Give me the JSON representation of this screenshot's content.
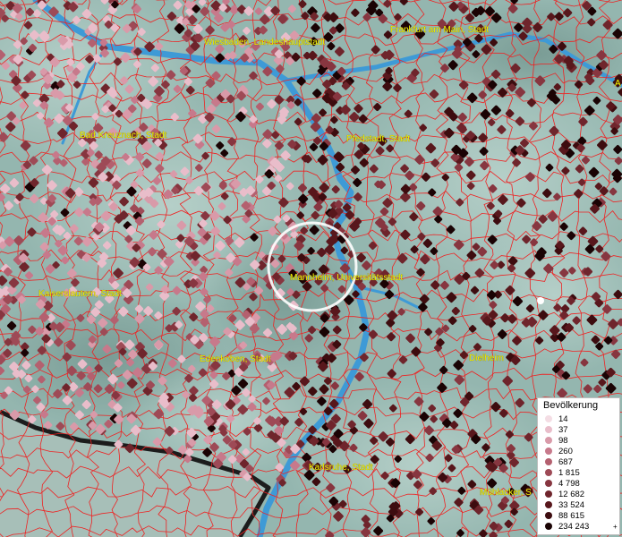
{
  "map": {
    "cities": [
      {
        "name": "Wiesbaden, Landeshauptstadt"
      },
      {
        "name": "Frankfurt am Main, Stadt"
      },
      {
        "name": "Bad Kreuznach, Stadt"
      },
      {
        "name": "Pfedstadt, Stadt"
      },
      {
        "name": "Mannheim, Universitätsstadt"
      },
      {
        "name": "Kaiserslautern, Stadt"
      },
      {
        "name": "Edenkoben, Stadt"
      },
      {
        "name": "Dielheim"
      },
      {
        "name": "Karlsruhe, Stadt"
      },
      {
        "name": "Mühlacker, S"
      },
      {
        "name": "A"
      }
    ]
  },
  "legend": {
    "title": "Bevölkerung",
    "items": [
      {
        "label": "14",
        "color": "#f4dde4"
      },
      {
        "label": "37",
        "color": "#e9bdca"
      },
      {
        "label": "98",
        "color": "#d99aa9"
      },
      {
        "label": "260",
        "color": "#c7798b"
      },
      {
        "label": "687",
        "color": "#b4606f"
      },
      {
        "label": "1 815",
        "color": "#9e4a56"
      },
      {
        "label": "4 798",
        "color": "#873640"
      },
      {
        "label": "12 682",
        "color": "#6f252c"
      },
      {
        "label": "33 524",
        "color": "#58171c"
      },
      {
        "label": "88 615",
        "color": "#3d0c0f"
      },
      {
        "label": "234 243",
        "color": "#1a0304"
      }
    ],
    "plus": "+"
  },
  "colors": {
    "water": "#3e9ad6",
    "boundary": "#ee2222",
    "terrain_light": "#a4c4bc",
    "terrain_dark": "#7e9f98",
    "border_line": "#1c1c1c"
  }
}
